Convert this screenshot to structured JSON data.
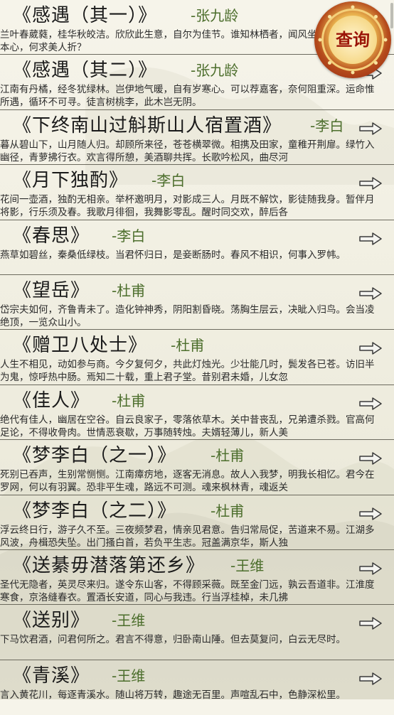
{
  "query_button": {
    "label": "查询"
  },
  "poems": [
    {
      "title": "《感遇（其一）》",
      "author": "-张九龄",
      "excerpt": "兰叶春葳蕤，桂华秋皎洁。欣欣此生意，自尔为佳节。谁知林栖者，闻风坐相悦。草木有本心，何求美人折？"
    },
    {
      "title": "《感遇（其二）》",
      "author": "-张九龄",
      "excerpt": "江南有丹橘，经冬犹绿林。岂伊地气暖，自有岁寒心。可以荐嘉客，奈何阻重深。运命惟所遇，循环不可寻。徒言树桃李，此木岂无阴。"
    },
    {
      "title": "《下终南山过斛斯山人宿置酒》",
      "author": "-李白",
      "excerpt": "暮从碧山下，山月随人归。却顾所来径，苍苍横翠微。相携及田家，童稚开荆扉。绿竹入幽径，青萝拂行衣。欢言得所憩，美酒聊共挥。长歌吟松风，曲尽河"
    },
    {
      "title": "《月下独酌》",
      "author": "-李白",
      "excerpt": "花间一壶酒，独酌无相亲。举杯邀明月，对影成三人。月既不解饮，影徒随我身。暂伴月将影，行乐须及春。我歌月徘徊，我舞影零乱。醒时同交欢，醉后各"
    },
    {
      "title": "《春思》",
      "author": "-李白",
      "excerpt": "燕草如碧丝，秦桑低绿枝。当君怀归日，是妾断肠时。春风不相识，何事入罗帏。"
    },
    {
      "title": "《望岳》",
      "author": "-杜甫",
      "excerpt": "岱宗夫如何，齐鲁青未了。造化钟神秀，阴阳割昏晓。荡胸生层云，决眦入归鸟。会当凌绝顶，一览众山小。"
    },
    {
      "title": "《赠卫八处士》",
      "author": "-杜甫",
      "excerpt": "人生不相见，动如参与商。今夕复何夕，共此灯烛光。少壮能几时，鬓发各已苍。访旧半为鬼，惊呼热中肠。焉知二十载，重上君子堂。昔别君未婚，儿女忽"
    },
    {
      "title": "《佳人》",
      "author": "-杜甫",
      "excerpt": "绝代有佳人，幽居在空谷。自云良家子，零落依草木。关中昔丧乱，兄弟遭杀戮。官高何足论，不得收骨肉。世情恶衰歇，万事随转烛。夫婿轻薄儿，新人美"
    },
    {
      "title": "《梦李白（之一）》",
      "author": "-杜甫",
      "excerpt": "死别已吞声，生别常恻恻。江南瘴疠地，逐客无消息。故人入我梦，明我长相忆。君今在罗网，何以有羽翼。恐非平生魂，路远不可测。魂来枫林青，魂返关"
    },
    {
      "title": "《梦李白（之二）》",
      "author": "-杜甫",
      "excerpt": "浮云终日行，游子久不至。三夜频梦君，情亲见君意。告归常局促，苦道来不易。江湖多风波，舟楫恐失坠。出门搔白首，若负平生志。冠盖满京华，斯人独"
    },
    {
      "title": "《送綦毋潜落第还乡》",
      "author": "-王维",
      "excerpt": "圣代无隐者，英灵尽来归。遂令东山客，不得顾采薇。既至金门远，孰云吾道非。江淮度寒食，京洛缝春衣。置酒长安道，同心与我违。行当浮桂棹，未几拂"
    },
    {
      "title": "《送别》",
      "author": "-王维",
      "excerpt": "下马饮君酒，问君何所之。君言不得意，归卧南山陲。但去莫复问，白云无尽时。"
    },
    {
      "title": "《青溪》",
      "author": "-王维",
      "excerpt": "言入黄花川，每逐青溪水。随山将万转，趣途无百里。声喧乱石中，色静深松里。"
    }
  ]
}
